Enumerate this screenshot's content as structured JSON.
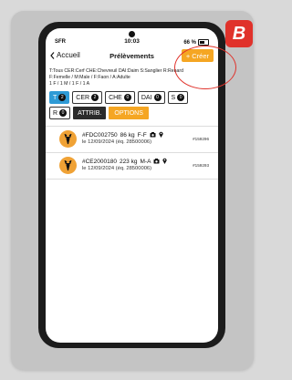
{
  "status_bar": {
    "carrier": "SFR",
    "time": "10:03",
    "battery": "66 %"
  },
  "nav": {
    "back_label": "Accueil",
    "title": "Prélèvements",
    "create_label": "Créer"
  },
  "legend": {
    "line1": "T:Tous CER:Cerf CHE:Chevreuil DAI:Daim S:Sanglier R:Renard",
    "line2": "F:Femelle / M:Male / F:Faon / A:Adulte",
    "line3": "1 F / 1 M / 1 F / 1 A"
  },
  "filters": {
    "chips_row1": [
      {
        "label": "T",
        "count": "2",
        "active": true
      },
      {
        "label": "CER",
        "count": "2",
        "active": false
      },
      {
        "label": "CHE",
        "count": "0",
        "active": false
      },
      {
        "label": "DAI",
        "count": "0",
        "active": false
      },
      {
        "label": "S",
        "count": "0",
        "active": false
      }
    ],
    "chip_r": {
      "label": "R",
      "count": "0"
    },
    "attrib_label": "ATTRIB.",
    "options_label": "OPTIONS"
  },
  "items": [
    {
      "id": "#FDC002750",
      "weight": "86 kg",
      "sex": "F-F",
      "date": "le 12/09/2024 (éq. 28500006)",
      "code": "#159296"
    },
    {
      "id": "#CE2000180",
      "weight": "223 kg",
      "sex": "M-A",
      "date": "le 12/09/2024 (éq. 28500006)",
      "code": "#159293"
    }
  ],
  "annotation": {
    "badge": "B"
  },
  "colors": {
    "accent_orange": "#f5a623",
    "active_blue": "#2f9bd6",
    "annotation_red": "#e0322b"
  }
}
